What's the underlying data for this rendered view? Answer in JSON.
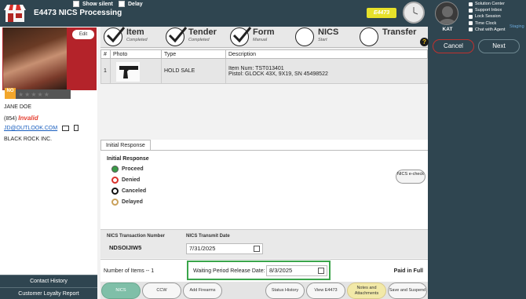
{
  "header": {
    "title": "E4473 NICS Processing",
    "show_silent_label": "Show silent",
    "delay_label": "Delay",
    "badge_text": "E4473"
  },
  "user": {
    "name": "KAT",
    "links": [
      "Solution Center",
      "Support Inbox",
      "Lock Session",
      "Time Clock",
      "Chat with Agent"
    ],
    "staging": "Staging"
  },
  "actions": {
    "cancel": "Cancel",
    "next": "Next"
  },
  "customer": {
    "edit_label": "Edit",
    "badge": "NO",
    "stars": "★★★★★",
    "name": "JANE DOE",
    "phone": "(854)",
    "phone_status": "Invalid",
    "email": "JD@OUTLOOK.COM",
    "company": "BLACK ROCK INC.",
    "contact_history": "Contact History",
    "loyalty_report": "Customer Loyalty Report"
  },
  "steps": [
    {
      "label": "Item",
      "sub": "Completed",
      "done": true
    },
    {
      "label": "Tender",
      "sub": "Completed",
      "done": true
    },
    {
      "label": "Form",
      "sub": "Manual",
      "done": true
    },
    {
      "label": "NICS",
      "sub": "Start",
      "done": false
    },
    {
      "label": "Transfer",
      "sub": "",
      "done": false
    }
  ],
  "table": {
    "headers": [
      "#",
      "Photo",
      "Type",
      "Description"
    ],
    "rows": [
      {
        "num": "1",
        "type": "HOLD SALE",
        "desc1": "Item Num: TST013401",
        "desc2": "Pistol: GLOCK 43X, 9X19, SN 45498522"
      }
    ]
  },
  "response": {
    "tab": "Initial Response",
    "title": "Initial Response",
    "options": [
      {
        "label": "Proceed",
        "color": "#3a9b48"
      },
      {
        "label": "Denied",
        "color": "#d9312b"
      },
      {
        "label": "Canceled",
        "color": "#111111"
      },
      {
        "label": "Delayed",
        "color": "#c9a05a"
      }
    ],
    "echeck": "NICS e-check"
  },
  "transaction": {
    "number_label": "NICS Transaction Number",
    "number": "NDSOIJIW5",
    "date_label": "NICS Transmit Date",
    "date": "7/31/2025"
  },
  "summary": {
    "items": "Number of Items -- 1",
    "waiting_label": "Waiting Period Release Date:",
    "waiting_date": "8/3/2025",
    "paid": "Paid in Full"
  },
  "bottom_buttons": [
    "NICS",
    "CCW",
    "Add Firearms",
    "Status History",
    "View E4473",
    "Notes and Attachments",
    "Save and Suspend"
  ]
}
